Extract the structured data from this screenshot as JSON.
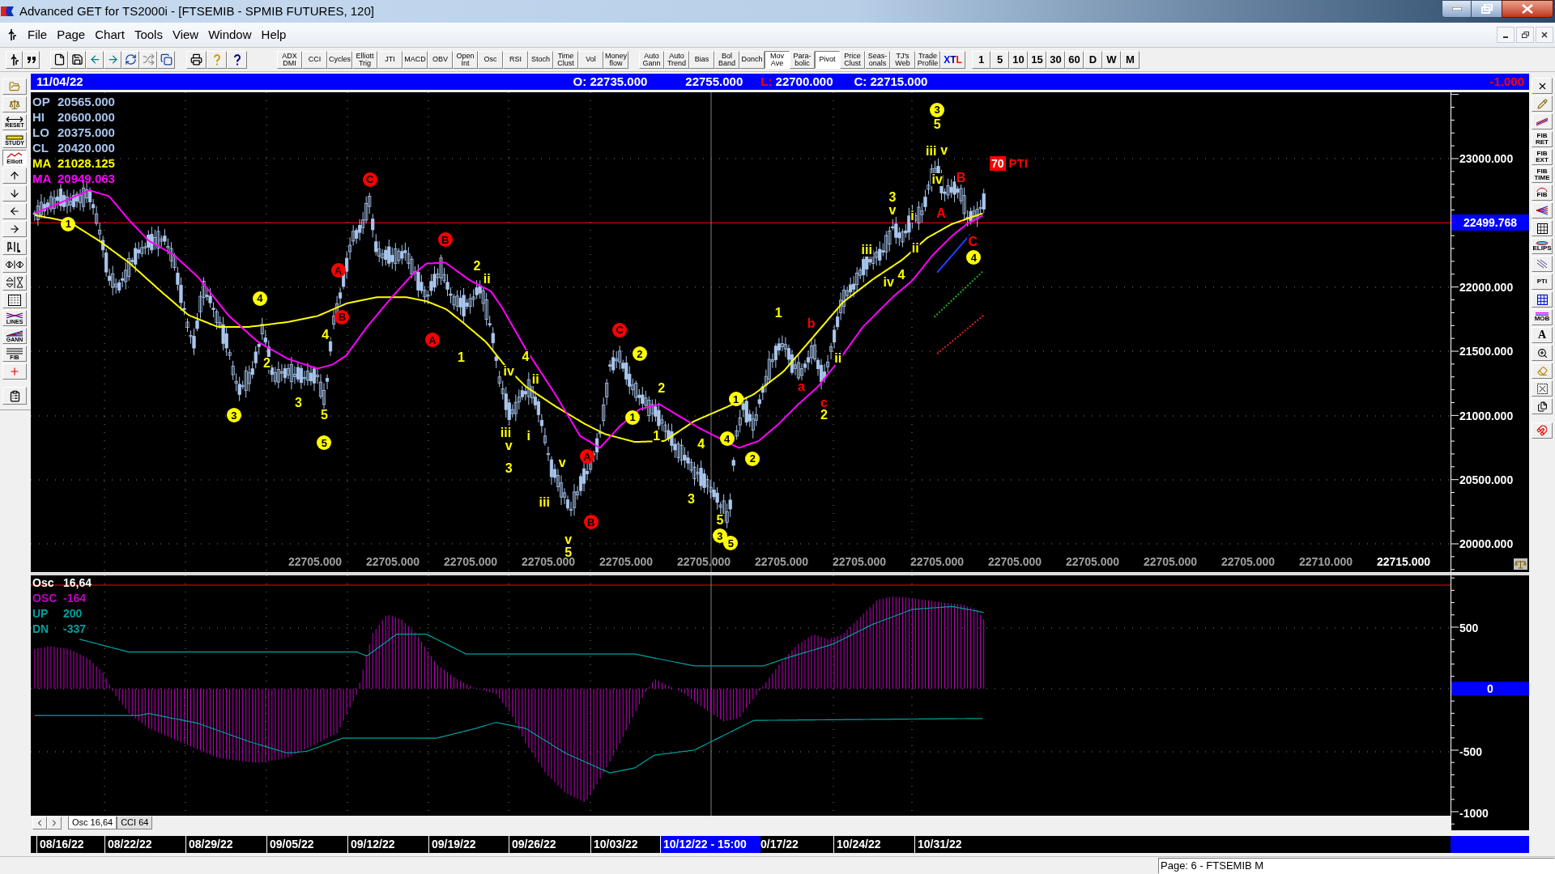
{
  "window": {
    "title": "Advanced GET for TS2000i - [FTSEMIB - SPMIB FUTURES, 120]"
  },
  "menu": [
    "File",
    "Page",
    "Chart",
    "Tools",
    "View",
    "Window",
    "Help"
  ],
  "toolbar": {
    "study_buttons": [
      {
        "label": "ADX DMI",
        "pressed": false
      },
      {
        "label": "CCI",
        "pressed": false
      },
      {
        "label": "Cycles",
        "pressed": false
      },
      {
        "label": "Elliott Trig",
        "pressed": false
      },
      {
        "label": "JTI",
        "pressed": false
      },
      {
        "label": "MACD",
        "pressed": false
      },
      {
        "label": "OBV",
        "pressed": false
      },
      {
        "label": "Open Int",
        "pressed": false
      },
      {
        "label": "Osc",
        "pressed": false
      },
      {
        "label": "RSI",
        "pressed": false
      },
      {
        "label": "Stoch",
        "pressed": false
      },
      {
        "label": "Time Clust",
        "pressed": false
      },
      {
        "label": "Vol",
        "pressed": false
      },
      {
        "label": "Money flow",
        "pressed": false
      }
    ],
    "tool_buttons": [
      {
        "label": "Auto Gann",
        "pressed": false
      },
      {
        "label": "Auto Trend",
        "pressed": false
      },
      {
        "label": "Bias",
        "pressed": false
      },
      {
        "label": "Bol Band",
        "pressed": false
      },
      {
        "label": "Donch",
        "pressed": false
      },
      {
        "label": "Mov Ave",
        "pressed": true
      },
      {
        "label": "Para-bolic",
        "pressed": false
      },
      {
        "label": "Pivot",
        "pressed": true
      },
      {
        "label": "Price Clust",
        "pressed": false
      },
      {
        "label": "Seas-onals",
        "pressed": false
      },
      {
        "label": "TJ's Web",
        "pressed": false
      },
      {
        "label": "Trade Profile",
        "pressed": false
      }
    ],
    "xtl_button": {
      "parts": [
        {
          "text": "X",
          "color": "#0000ff"
        },
        {
          "text": "T",
          "color": "#000080"
        },
        {
          "text": "L",
          "color": "#ff0000"
        }
      ]
    },
    "intervals": [
      "1",
      "5",
      "10",
      "15",
      "30",
      "60",
      "D",
      "W",
      "M"
    ]
  },
  "left_toolbar": [
    {
      "label": "RESET",
      "pressed": false
    },
    {
      "label": "STUDY",
      "pressed": false
    },
    {
      "label": "Elliott",
      "pressed": true
    },
    {
      "label": "LINES",
      "pressed": false
    },
    {
      "label": "GANN",
      "pressed": false
    },
    {
      "label": "FIB",
      "pressed": false
    }
  ],
  "chart": {
    "info_bar": {
      "date": "11/04/22",
      "readings": [
        {
          "label": "O:",
          "value": "22735.000",
          "color": "#ffffff"
        },
        {
          "value": "22755.000"
        },
        {
          "label": "L:",
          "value": "22700.000",
          "color": "#ff0000"
        },
        {
          "label": "C:",
          "value": "22715.000",
          "color": "#ffffff"
        }
      ],
      "change": "-1.000"
    },
    "legend": [
      {
        "label": "OP",
        "value": "20565.000",
        "color": "#a8c4ec"
      },
      {
        "label": "HI",
        "value": "20600.000",
        "color": "#a8c4ec"
      },
      {
        "label": "LO",
        "value": "20375.000",
        "color": "#a8c4ec"
      },
      {
        "label": "CL",
        "value": "20420.000",
        "color": "#a8c4ec"
      },
      {
        "label": "MA",
        "value": "21028.125",
        "color": "#ffff00"
      },
      {
        "label": "MA",
        "value": "20949.063",
        "color": "#ff00ff"
      }
    ],
    "wave_labels": [
      {
        "text": "1",
        "circled": true,
        "color": "#ffff00"
      },
      {
        "text": "4",
        "circled": true,
        "color": "#ffff00"
      },
      {
        "text": "2",
        "circled": false,
        "color": "#ffff00"
      },
      {
        "text": "3",
        "circled": true,
        "color": "#ffff00"
      },
      {
        "text": "3",
        "circled": false,
        "color": "#ffff00"
      },
      {
        "text": "4",
        "circled": false,
        "color": "#ffff00"
      },
      {
        "text": "5",
        "circled": false,
        "color": "#ffff00"
      },
      {
        "text": "5",
        "circled": true,
        "color": "#ffff00"
      },
      {
        "text": "A",
        "circled": true,
        "color": "#ff0000"
      },
      {
        "text": "B",
        "circled": true,
        "color": "#ff0000"
      },
      {
        "text": "C",
        "circled": true,
        "color": "#ff0000"
      },
      {
        "text": "B",
        "circled": true,
        "color": "#ff0000"
      },
      {
        "text": "A",
        "circled": true,
        "color": "#ff0000"
      },
      {
        "text": "1",
        "circled": false,
        "color": "#ffff00"
      },
      {
        "text": "2",
        "circled": false,
        "color": "#ffff00"
      },
      {
        "text": "ii",
        "circled": false,
        "color": "#ffff00"
      },
      {
        "text": "iv",
        "circled": false,
        "color": "#ffff00"
      },
      {
        "text": "4",
        "circled": false,
        "color": "#ffff00"
      },
      {
        "text": "ii",
        "circled": false,
        "color": "#ffff00"
      },
      {
        "text": "iii",
        "circled": false,
        "color": "#ffff00"
      },
      {
        "text": "i",
        "circled": false,
        "color": "#ffff00"
      },
      {
        "text": "v",
        "circled": false,
        "color": "#ffff00"
      },
      {
        "text": "3",
        "circled": false,
        "color": "#ffff00"
      },
      {
        "text": "v",
        "circled": false,
        "color": "#ffff00"
      },
      {
        "text": "iii",
        "circled": false,
        "color": "#ffff00"
      },
      {
        "text": "v",
        "circled": false,
        "color": "#ffff00"
      },
      {
        "text": "5",
        "circled": false,
        "color": "#ffff00"
      },
      {
        "text": "A",
        "circled": true,
        "color": "#ff0000"
      },
      {
        "text": "B",
        "circled": true,
        "color": "#ff0000"
      },
      {
        "text": "C",
        "circled": true,
        "color": "#ff0000"
      },
      {
        "text": "2",
        "circled": true,
        "color": "#ffff00"
      },
      {
        "text": "1",
        "circled": true,
        "color": "#ffff00"
      },
      {
        "text": "2",
        "circled": false,
        "color": "#ffff00"
      },
      {
        "text": "1",
        "circled": false,
        "color": "#ffff00"
      },
      {
        "text": "4",
        "circled": false,
        "color": "#ffff00"
      },
      {
        "text": "3",
        "circled": false,
        "color": "#ffff00"
      },
      {
        "text": "5",
        "circled": false,
        "color": "#ffff00"
      },
      {
        "text": "3",
        "circled": true,
        "color": "#ffff00"
      },
      {
        "text": "5",
        "circled": true,
        "color": "#ffff00"
      },
      {
        "text": "4",
        "circled": true,
        "color": "#ffff00"
      },
      {
        "text": "1",
        "circled": true,
        "color": "#ffff00"
      },
      {
        "text": "2",
        "circled": true,
        "color": "#ffff00"
      },
      {
        "text": "1",
        "circled": false,
        "color": "#ffff00"
      },
      {
        "text": "b",
        "circled": false,
        "color": "#ff0000"
      },
      {
        "text": "a",
        "circled": false,
        "color": "#ff0000"
      },
      {
        "text": "c",
        "circled": false,
        "color": "#ff0000"
      },
      {
        "text": "2",
        "circled": false,
        "color": "#ffff00"
      },
      {
        "text": "ii",
        "circled": false,
        "color": "#ffff00"
      },
      {
        "text": "iii",
        "circled": false,
        "color": "#ffff00"
      },
      {
        "text": "iv",
        "circled": false,
        "color": "#ffff00"
      },
      {
        "text": "4",
        "circled": false,
        "color": "#ffff00"
      },
      {
        "text": "3",
        "circled": false,
        "color": "#ffff00"
      },
      {
        "text": "v",
        "circled": false,
        "color": "#ffff00"
      },
      {
        "text": "i",
        "circled": false,
        "color": "#ffff00"
      },
      {
        "text": "ii",
        "circled": false,
        "color": "#ffff00"
      },
      {
        "text": "3",
        "circled": true,
        "color": "#ffff00"
      },
      {
        "text": "5",
        "circled": false,
        "color": "#ffff00"
      },
      {
        "text": "iii",
        "circled": false,
        "color": "#ffff00"
      },
      {
        "text": "v",
        "circled": false,
        "color": "#ffff00"
      },
      {
        "text": "iv",
        "circled": false,
        "color": "#ffff00"
      },
      {
        "text": "A",
        "circled": false,
        "color": "#ff0000"
      },
      {
        "text": "B",
        "circled": false,
        "color": "#ff0000"
      },
      {
        "text": "C",
        "circled": false,
        "color": "#ff0000"
      },
      {
        "text": "4",
        "circled": true,
        "color": "#ffff00"
      }
    ],
    "pti": {
      "value": "70",
      "label": "PTI"
    },
    "price_axis": {
      "labels": [
        "23000.000",
        "22000.000",
        "21500.000",
        "21000.000",
        "20500.000",
        "20000.000"
      ],
      "current": "22499.768"
    },
    "time_values": [
      {
        "text": "22705.000",
        "current": false
      },
      {
        "text": "22705.000",
        "current": false
      },
      {
        "text": "22705.000",
        "current": false
      },
      {
        "text": "22705.000",
        "current": false
      },
      {
        "text": "22705.000",
        "current": false
      },
      {
        "text": "22705.000",
        "current": false
      },
      {
        "text": "22705.000",
        "current": false
      },
      {
        "text": "22705.000",
        "current": false
      },
      {
        "text": "22705.000",
        "current": false
      },
      {
        "text": "22705.000",
        "current": false
      },
      {
        "text": "22705.000",
        "current": false
      },
      {
        "text": "22705.000",
        "current": false
      },
      {
        "text": "22705.000",
        "current": false
      },
      {
        "text": "22710.000",
        "current": false
      },
      {
        "text": "22715.000",
        "current": true
      }
    ]
  },
  "right_toolbar": [
    "FIB RET",
    "FIB EXT",
    "FIB TIME",
    "FIB",
    "ELIPS",
    "PTI",
    "MOB",
    "A"
  ],
  "oscillator": {
    "legend": [
      {
        "label": "Osc",
        "value": "16,64",
        "color": "#ffffff"
      },
      {
        "label": "OSC",
        "value": "-164",
        "color": "#c000c0"
      },
      {
        "label": "UP",
        "value": "200",
        "color": "#00a0a0"
      },
      {
        "label": "DN",
        "value": "-337",
        "color": "#00a0a0"
      }
    ],
    "axis": {
      "labels": [
        "500",
        "-500",
        "-1000"
      ],
      "zero": "0"
    }
  },
  "oscillator_tabs": [
    {
      "label": "Osc 16,64",
      "selected": true
    },
    {
      "label": "CCI 64",
      "selected": false
    }
  ],
  "date_axis": [
    {
      "text": "08/16/22",
      "selected": false
    },
    {
      "text": "08/22/22",
      "selected": false
    },
    {
      "text": "08/29/22",
      "selected": false
    },
    {
      "text": "09/05/22",
      "selected": false
    },
    {
      "text": "09/12/22",
      "selected": false
    },
    {
      "text": "09/19/22",
      "selected": false
    },
    {
      "text": "09/26/22",
      "selected": false
    },
    {
      "text": "10/03/22",
      "selected": false
    },
    {
      "text": "10/12/22 - 15:00",
      "selected": true
    },
    {
      "text": "0/17/22",
      "selected": false
    },
    {
      "text": "10/24/22",
      "selected": false
    },
    {
      "text": "10/31/22",
      "selected": false
    }
  ],
  "status_bar": {
    "page": "Page: 6 - FTSEMIB M"
  }
}
